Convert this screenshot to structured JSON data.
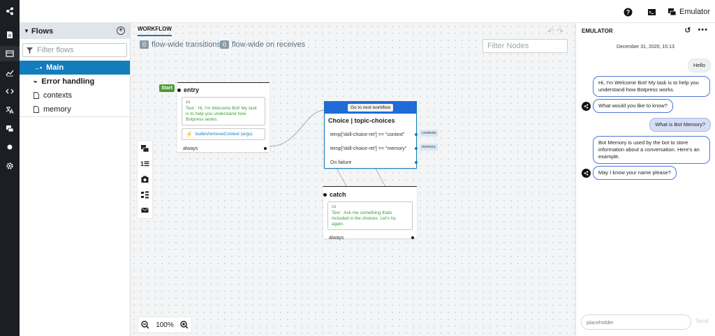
{
  "rail": {
    "icons": [
      "share-icon",
      "document-icon",
      "flows-icon",
      "analytics-icon",
      "code-icon",
      "translate-icon",
      "qna-icon",
      "dot-icon",
      "settings-icon"
    ]
  },
  "topbar": {
    "emulator_label": "Emulator"
  },
  "flows": {
    "header": "Flows",
    "filter_placeholder": "Filter flows",
    "items": [
      {
        "label": "Main",
        "icon": "flow-arrow-icon",
        "active": true
      },
      {
        "label": "Error handling",
        "icon": "error-flow-icon"
      },
      {
        "label": "contexts",
        "icon": "file-icon"
      },
      {
        "label": "memory",
        "icon": "file-icon"
      }
    ]
  },
  "workflow": {
    "tab": "WORKFLOW",
    "transitions": {
      "count": "0",
      "label": "flow-wide transitions"
    },
    "receives": {
      "count": "0",
      "label": "flow-wide on receives"
    },
    "filter_nodes_placeholder": "Filter Nodes",
    "zoom": "100%"
  },
  "nodes": {
    "entry": {
      "start": "Start",
      "title": "entry",
      "say": "Text : Hi, I'm Welcome Bot! My task is to help you understand how Botpress works.",
      "action": "builtin/removeContext (args)",
      "transition": "always"
    },
    "choice": {
      "button": "Go to next workflow",
      "title": "Choice | topic-choices",
      "cond1": "temp['skill-choice-ret'] == \"context\"",
      "cond1_tag": "contexts",
      "cond2": "temp['skill-choice-ret'] == \"memory\"",
      "cond2_tag": "memory",
      "failure": "On failure"
    },
    "catch": {
      "title": "catch",
      "say": "Text : Ask me something thats included in the choices. Let's try again.",
      "transition": "always"
    }
  },
  "emulator": {
    "title": "EMULATOR",
    "date": "December 31, 2020, 15:13",
    "messages": {
      "m1": "Hello",
      "m2": "Hi, I'm Welcome Bot! My task is to help you understand how Botpress works.",
      "m3": "What would you like to know?",
      "m4": "What is Bot Memory?",
      "m5": "Bot Memory is used by the bot to store information about a conversation. Here's an example.",
      "m6": "May I know your name please?"
    },
    "input_placeholder": "placeholder",
    "send_label": "Send"
  }
}
